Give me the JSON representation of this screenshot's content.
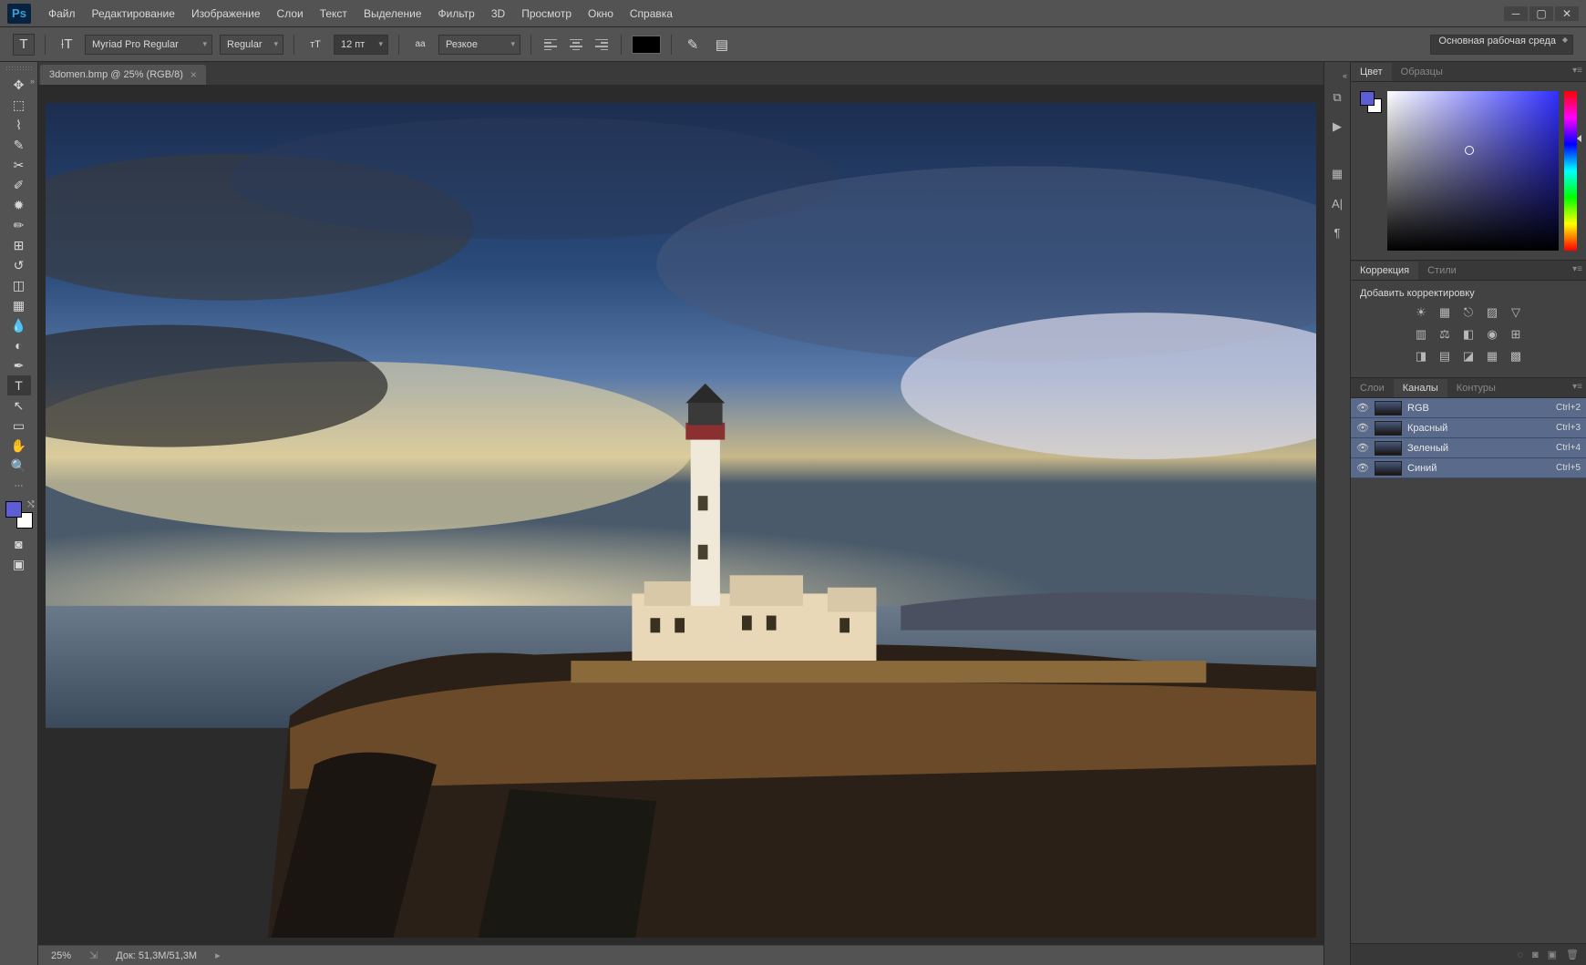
{
  "app": {
    "logo": "Ps"
  },
  "menu": [
    "Файл",
    "Редактирование",
    "Изображение",
    "Слои",
    "Текст",
    "Выделение",
    "Фильтр",
    "3D",
    "Просмотр",
    "Окно",
    "Справка"
  ],
  "options": {
    "font_family": "Myriad Pro Regular",
    "font_style": "Regular",
    "font_size": "12 пт",
    "antialias": "Резкое",
    "workspace": "Основная рабочая среда"
  },
  "document": {
    "tab_title": "3domen.bmp @ 25% (RGB/8)",
    "zoom": "25%",
    "doc_info": "Док: 51,3M/51,3M"
  },
  "panels": {
    "color_tab": "Цвет",
    "swatches_tab": "Образцы",
    "corrections_tab": "Коррекция",
    "styles_tab": "Стили",
    "add_adjustment": "Добавить корректировку",
    "layers_tab": "Слои",
    "channels_tab": "Каналы",
    "paths_tab": "Контуры"
  },
  "channels": [
    {
      "name": "RGB",
      "shortcut": "Ctrl+2"
    },
    {
      "name": "Красный",
      "shortcut": "Ctrl+3"
    },
    {
      "name": "Зеленый",
      "shortcut": "Ctrl+4"
    },
    {
      "name": "Синий",
      "shortcut": "Ctrl+5"
    }
  ],
  "colors": {
    "foreground": "#5d5dd6",
    "background": "#ffffff"
  }
}
